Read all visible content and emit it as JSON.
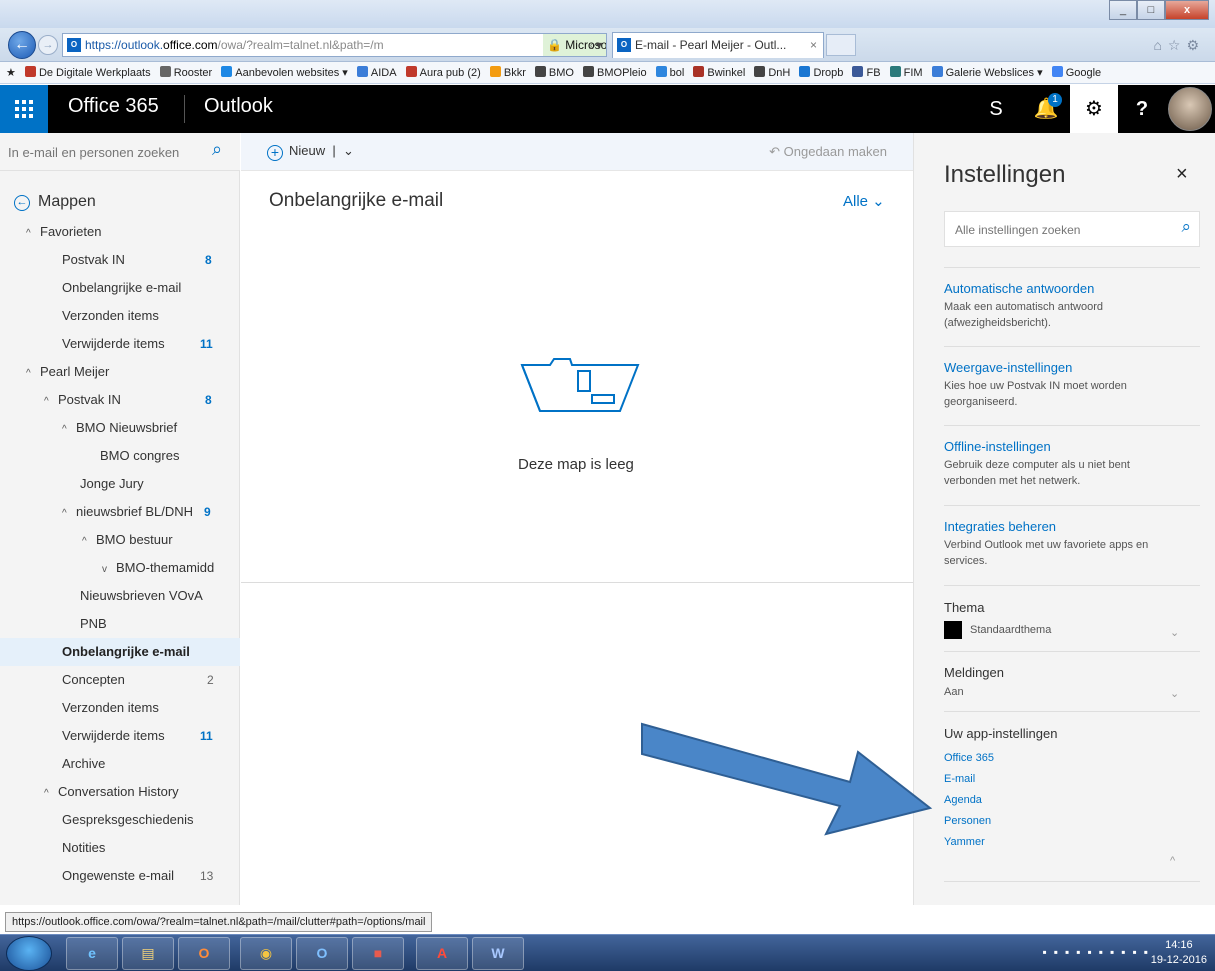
{
  "browser": {
    "window_title_buttons": [
      "_",
      "□",
      "x"
    ],
    "url_prefix": "https://outlook.",
    "url_host": "office.com",
    "url_rest": "/owa/?realm=talnet.nl&path=/m",
    "cert": "Microsoft Corporation [US]",
    "tab_title": "E-mail - Pearl Meijer - Outl...",
    "favorites": [
      "De Digitale Werkplaats",
      "Rooster",
      "Aanbevolen websites ▾",
      "AIDA",
      "Aura pub (2)",
      "Bkkr",
      "BMO",
      "BMOPleio",
      "bol",
      "Bwinkel",
      "DnH",
      "Dropb",
      "FB",
      "FIM",
      "Galerie Webslices ▾",
      "Google"
    ],
    "status_url": "https://outlook.office.com/owa/?realm=talnet.nl&path=/mail/clutter#path=/options/mail"
  },
  "topbar": {
    "brand": "Office 365",
    "app": "Outlook",
    "notification_count": "1",
    "help": "?",
    "skype": "S"
  },
  "left": {
    "search_placeholder": "In e-mail en personen zoeken",
    "mappen": "Mappen",
    "folders": [
      {
        "label": "Favorieten",
        "count": ""
      },
      {
        "label": "Postvak IN",
        "count": "8"
      },
      {
        "label": "Onbelangrijke e-mail",
        "count": ""
      },
      {
        "label": "Verzonden items",
        "count": ""
      },
      {
        "label": "Verwijderde items",
        "count": "11"
      },
      {
        "label": "Pearl Meijer",
        "count": ""
      },
      {
        "label": "Postvak IN",
        "count": "8"
      },
      {
        "label": "BMO Nieuwsbrief",
        "count": ""
      },
      {
        "label": "BMO congres",
        "count": ""
      },
      {
        "label": "Jonge Jury",
        "count": ""
      },
      {
        "label": "nieuwsbrief BL/DNH",
        "count": "9"
      },
      {
        "label": "BMO bestuur",
        "count": ""
      },
      {
        "label": "BMO-themamidd",
        "count": ""
      },
      {
        "label": "Nieuwsbrieven VOvA",
        "count": ""
      },
      {
        "label": "PNB",
        "count": ""
      },
      {
        "label": "Onbelangrijke e-mail",
        "count": ""
      },
      {
        "label": "Concepten",
        "count": "2"
      },
      {
        "label": "Verzonden items",
        "count": ""
      },
      {
        "label": "Verwijderde items",
        "count": "11"
      },
      {
        "label": "Archive",
        "count": ""
      },
      {
        "label": "Conversation History",
        "count": ""
      },
      {
        "label": "Gespreksgeschiedenis",
        "count": ""
      },
      {
        "label": "Notities",
        "count": ""
      },
      {
        "label": "Ongewenste e-mail",
        "count": "13"
      }
    ]
  },
  "middle": {
    "new_label": "Nieuw",
    "undo_label": "Ongedaan maken",
    "list_title": "Onbelangrijke e-mail",
    "filter_label": "Alle",
    "empty_message": "Deze map is leeg"
  },
  "settings": {
    "title": "Instellingen",
    "search_placeholder": "Alle instellingen zoeken",
    "items": [
      {
        "title": "Automatische antwoorden",
        "desc": "Maak een automatisch antwoord (afwezigheidsbericht)."
      },
      {
        "title": "Weergave-instellingen",
        "desc": "Kies hoe uw Postvak IN moet worden georganiseerd."
      },
      {
        "title": "Offline-instellingen",
        "desc": "Gebruik deze computer als u niet bent verbonden met het netwerk."
      },
      {
        "title": "Integraties beheren",
        "desc": "Verbind Outlook met uw favoriete apps en services."
      }
    ],
    "theme_label": "Thema",
    "theme_value": "Standaardthema",
    "notif_label": "Meldingen",
    "notif_value": "Aan",
    "app_settings_label": "Uw app-instellingen",
    "app_links": [
      "Office 365",
      "E-mail",
      "Agenda",
      "Personen",
      "Yammer"
    ]
  },
  "taskbar": {
    "time": "14:16",
    "date": "19-12-2016"
  },
  "colors": {
    "accent": "#0072c6",
    "topbar": "#000000",
    "arrow": "#4a86c8"
  }
}
